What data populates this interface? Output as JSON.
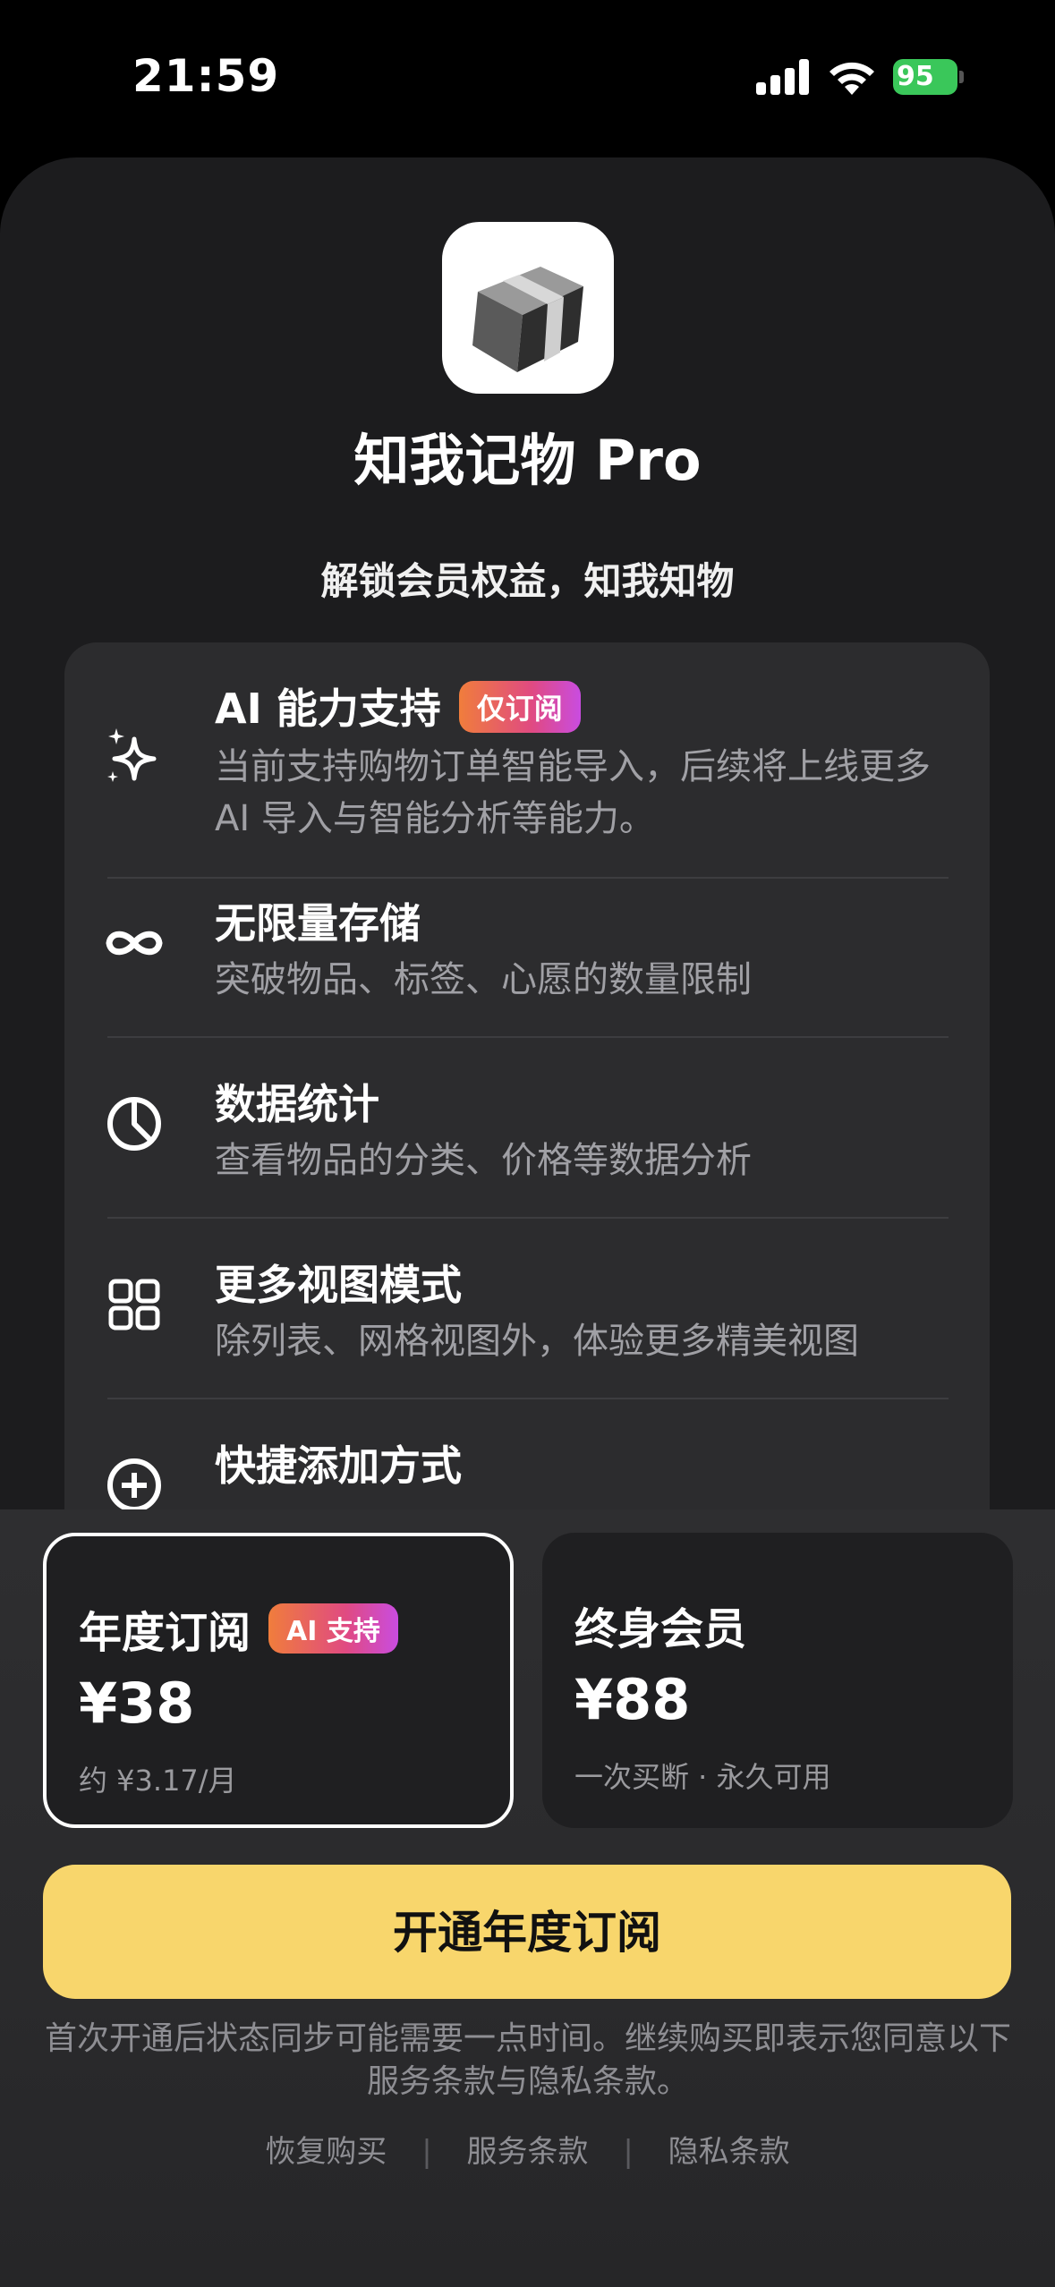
{
  "status_bar": {
    "time": "21:59",
    "battery": "95"
  },
  "app": {
    "icon": "cube-icon",
    "title": "知我记物 Pro",
    "subtitle": "解锁会员权益，知我知物"
  },
  "features": [
    {
      "icon": "sparkles-icon",
      "title": "AI 能力支持",
      "badge": "仅订阅",
      "desc": "当前支持购物订单智能导入，后续将上线更多 AI 导入与智能分析等能力。"
    },
    {
      "icon": "infinity-icon",
      "title": "无限量存储",
      "desc": "突破物品、标签、心愿的数量限制"
    },
    {
      "icon": "pie-chart-icon",
      "title": "数据统计",
      "desc": "查看物品的分类、价格等数据分析"
    },
    {
      "icon": "grid-icon",
      "title": "更多视图模式",
      "desc": "除列表、网格视图外，体验更多精美视图"
    },
    {
      "icon": "plus-circle-icon",
      "title": "快捷添加方式"
    }
  ],
  "plans": {
    "annual": {
      "name": "年度订阅",
      "badge": "AI 支持",
      "price": "¥38",
      "note": "约 ¥3.17/月"
    },
    "lifetime": {
      "name": "终身会员",
      "price": "¥88",
      "note": "一次买断 · 永久可用"
    }
  },
  "cta_label": "开通年度订阅",
  "legal_text": "首次开通后状态同步可能需要一点时间。继续购买即表示您同意以下服务条款与隐私条款。",
  "links": {
    "restore": "恢复购买",
    "terms": "服务条款",
    "privacy": "隐私条款",
    "separator": "|"
  },
  "colors": {
    "accent": "#f8d66c",
    "sheet": "#1c1c1e",
    "card": "#2c2c2e",
    "battery": "#3ac75a"
  }
}
